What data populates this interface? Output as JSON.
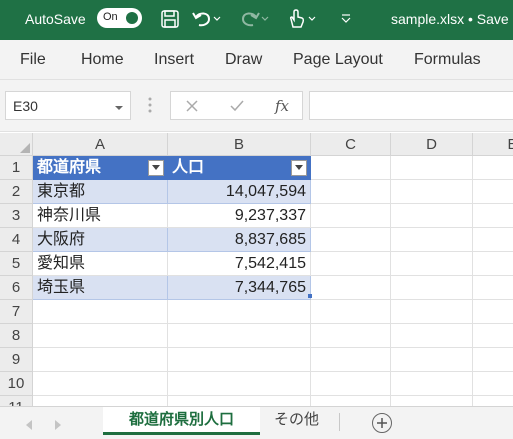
{
  "titlebar": {
    "autosave_label": "AutoSave",
    "toggle_state": "On",
    "filename": "sample.xlsx • Save"
  },
  "ribbon": {
    "tabs": [
      "File",
      "Home",
      "Insert",
      "Draw",
      "Page Layout",
      "Formulas"
    ]
  },
  "formula_bar": {
    "name_box": "E30",
    "fx_label": "fx",
    "formula": ""
  },
  "columns": [
    "A",
    "B",
    "C",
    "D",
    "E"
  ],
  "rows": [
    "1",
    "2",
    "3",
    "4",
    "5",
    "6",
    "7",
    "8",
    "9",
    "10",
    "11"
  ],
  "table": {
    "headers": [
      "都道府県",
      "人口"
    ],
    "data": [
      [
        "東京都",
        "14,047,594"
      ],
      [
        "神奈川県",
        "9,237,337"
      ],
      [
        "大阪府",
        "8,837,685"
      ],
      [
        "愛知県",
        "7,542,415"
      ],
      [
        "埼玉県",
        "7,344,765"
      ]
    ]
  },
  "sheets": {
    "active": "都道府県別人口",
    "other": "その他"
  },
  "colors": {
    "title_bar": "#1f7145",
    "table_header": "#4472c4",
    "table_band": "#d9e1f2"
  }
}
